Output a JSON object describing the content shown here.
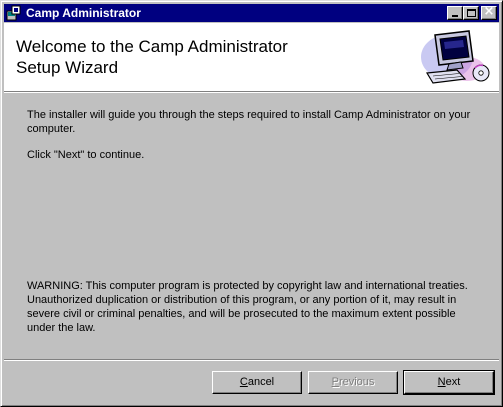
{
  "window": {
    "title": "Camp Administrator",
    "controls": {
      "minimize": "minimize-icon",
      "maximize": "maximize-icon",
      "close": "close-icon"
    },
    "colors": {
      "titlebar": "#000080",
      "face": "#c0c0c0"
    }
  },
  "banner": {
    "title": "Welcome to the Camp Administrator\nSetup Wizard",
    "art": "computer-setup-icon"
  },
  "content": {
    "intro": "The installer will guide you through the steps required to install Camp Administrator on your computer.",
    "instruction": "Click \"Next\" to continue.",
    "warning": "WARNING: This computer program is protected by copyright law and international treaties. Unauthorized duplication or distribution of this program, or any portion of it, may result in severe civil or criminal penalties, and will be prosecuted to the maximum extent possible under the law."
  },
  "buttons": {
    "cancel": {
      "accel": "C",
      "rest": "ancel"
    },
    "previous": {
      "accel": "P",
      "rest": "revious",
      "enabled": false
    },
    "next": {
      "accel": "N",
      "rest": "ext"
    }
  }
}
